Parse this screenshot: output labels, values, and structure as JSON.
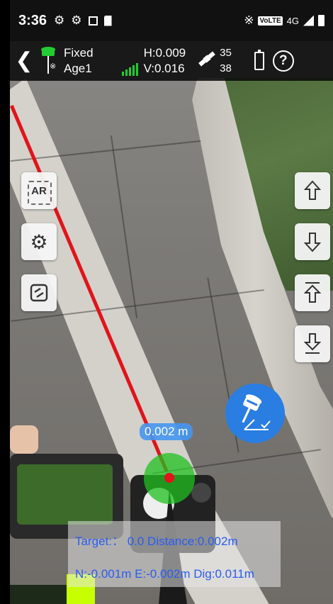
{
  "status_bar": {
    "time": "3:36",
    "icons": [
      "gear-icon",
      "gear-icon",
      "image-icon",
      "sim-icon"
    ],
    "right_icons": [
      "bluetooth-icon",
      "volte-icon",
      "signal-4g-icon",
      "battery-icon"
    ],
    "volte": "VoLTE",
    "network": "4G"
  },
  "header": {
    "fix_status": "Fixed",
    "age": "Age1",
    "h_precision": "H:0.009",
    "v_precision": "V:0.016",
    "sat_used": "35",
    "sat_total": "38",
    "fix_color": "#22cc33"
  },
  "side_left": {
    "ar_label": "AR"
  },
  "overlay": {
    "distance_label": "0.002 m"
  },
  "info": {
    "line1": "Target:： 0.0 Distance:0.002m",
    "line2": "N:-0.001m E:-0.002m Dig:0.011m"
  },
  "colors": {
    "accent_blue": "#2a7de1",
    "guide_red": "#e0141a",
    "info_text": "#2a5cf0"
  }
}
